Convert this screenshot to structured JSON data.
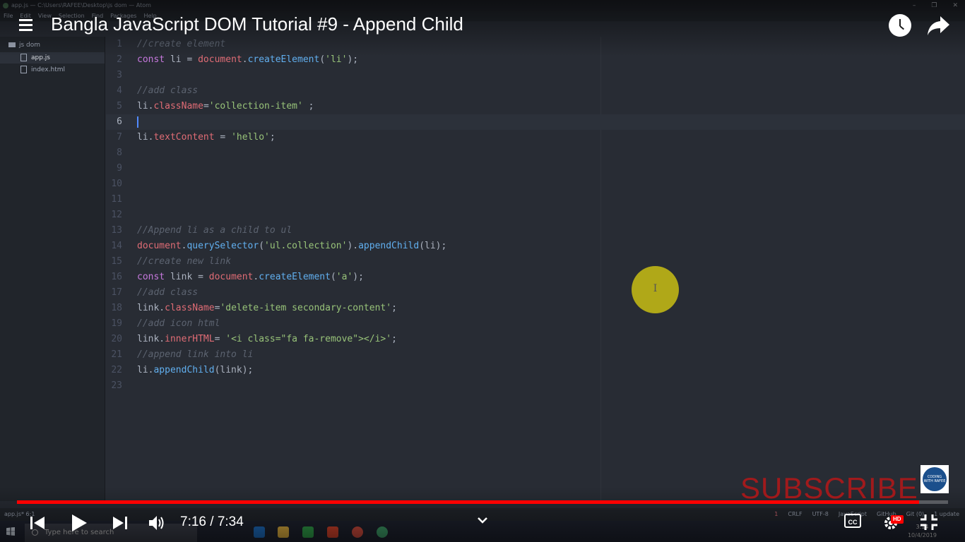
{
  "atom": {
    "window_title": "app.js — C:\\Users\\RAFEE\\Desktop\\js dom — Atom",
    "window_controls": [
      "–",
      "❐",
      "✕"
    ],
    "menu": [
      "File",
      "Edit",
      "View",
      "Selection",
      "Find",
      "Packages",
      "Help"
    ],
    "tree": {
      "folder": "js dom",
      "files": [
        "app.js",
        "index.html"
      ]
    },
    "code_lines": [
      "//create element",
      "const li = document.createElement('li');",
      "",
      "//add class",
      "li.className='collection-item' ;",
      "",
      "li.textContent = 'hello';",
      "",
      "",
      "",
      "",
      "",
      "//Append li as a child to ul",
      "document.querySelector('ul.collection').appendChild(li);",
      "//create new link",
      "const link = document.createElement('a');",
      "//add class",
      "link.className='delete-item secondary-content';",
      "//add icon html",
      "link.innerHTML= '<i class=\"fa fa-remove\"></i>';",
      "//append link into li",
      "li.appendChild(link);",
      ""
    ],
    "active_line": 6,
    "status": {
      "left": "app.js*   6:1",
      "right": [
        "1",
        "CRLF",
        "UTF-8",
        "JavaScript",
        "GitHub",
        "Git (0)",
        "1 update"
      ]
    }
  },
  "taskbar": {
    "search_placeholder": "Type here to search",
    "time": "3:14",
    "date": "10/4/2019"
  },
  "youtube": {
    "title": "Bangla JavaScript DOM Tutorial #9 - Append Child",
    "time_display": "7:16 / 7:34",
    "progress_fraction": 0.969,
    "subscribe_text": "SUBSCRIBE",
    "cc_label": "CC",
    "hd_label": "HD",
    "badge_text": "CODING WITH RAFEE",
    "accent_color": "#ff0000"
  }
}
